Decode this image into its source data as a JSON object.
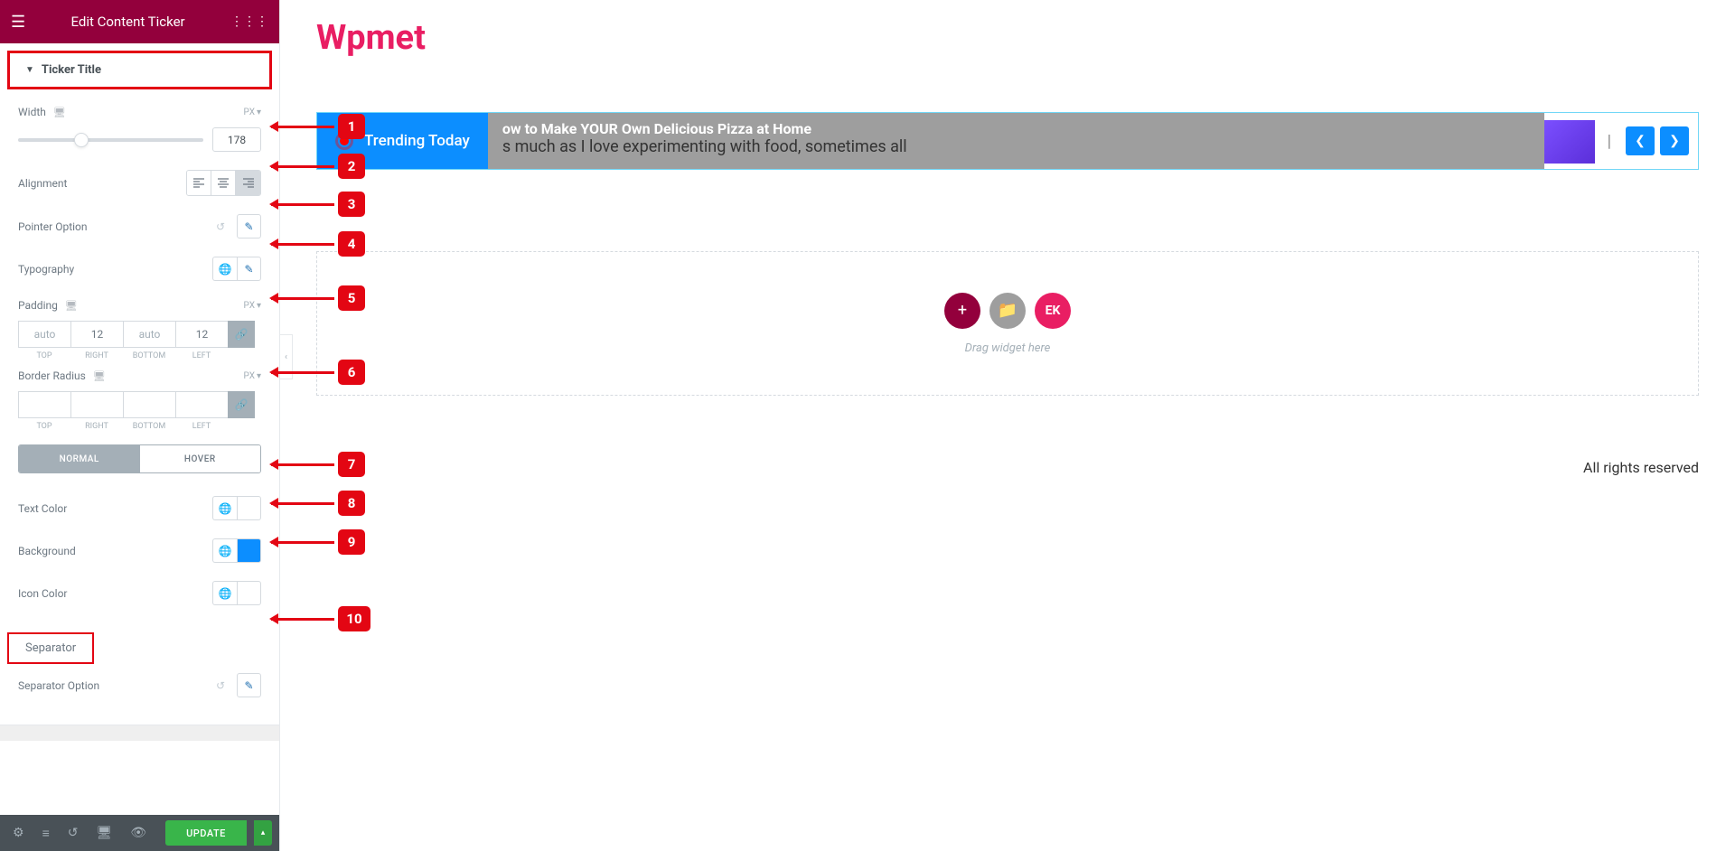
{
  "header": {
    "title": "Edit Content Ticker"
  },
  "brand": "Wpmet",
  "section": {
    "title": "Ticker Title"
  },
  "controls": {
    "width": {
      "label": "Width",
      "unit": "PX",
      "value": "178"
    },
    "alignment": {
      "label": "Alignment"
    },
    "pointer": {
      "label": "Pointer Option"
    },
    "typography": {
      "label": "Typography"
    },
    "padding": {
      "label": "Padding",
      "unit": "PX",
      "top": "auto",
      "right": "12",
      "bottom": "auto",
      "left": "12"
    },
    "radius": {
      "label": "Border Radius",
      "unit": "PX"
    },
    "tabs": {
      "normal": "NORMAL",
      "hover": "HOVER"
    },
    "textcolor": {
      "label": "Text Color"
    },
    "background": {
      "label": "Background"
    },
    "iconcolor": {
      "label": "Icon Color"
    },
    "separator_heading": "Separator",
    "separator_option": {
      "label": "Separator Option"
    },
    "dim_labels": {
      "top": "TOP",
      "right": "RIGHT",
      "bottom": "BOTTOM",
      "left": "LEFT"
    }
  },
  "footer": {
    "update": "UPDATE"
  },
  "ticker": {
    "title": "Trending Today",
    "headline": "ow to Make YOUR Own Delicious Pizza at Home",
    "subline": "s much as I love experimenting with food, sometimes all"
  },
  "dropzone": {
    "text": "Drag widget here",
    "ek": "EK"
  },
  "rights": "All rights reserved",
  "annotations": [
    "1",
    "2",
    "3",
    "4",
    "5",
    "6",
    "7",
    "8",
    "9",
    "10"
  ]
}
